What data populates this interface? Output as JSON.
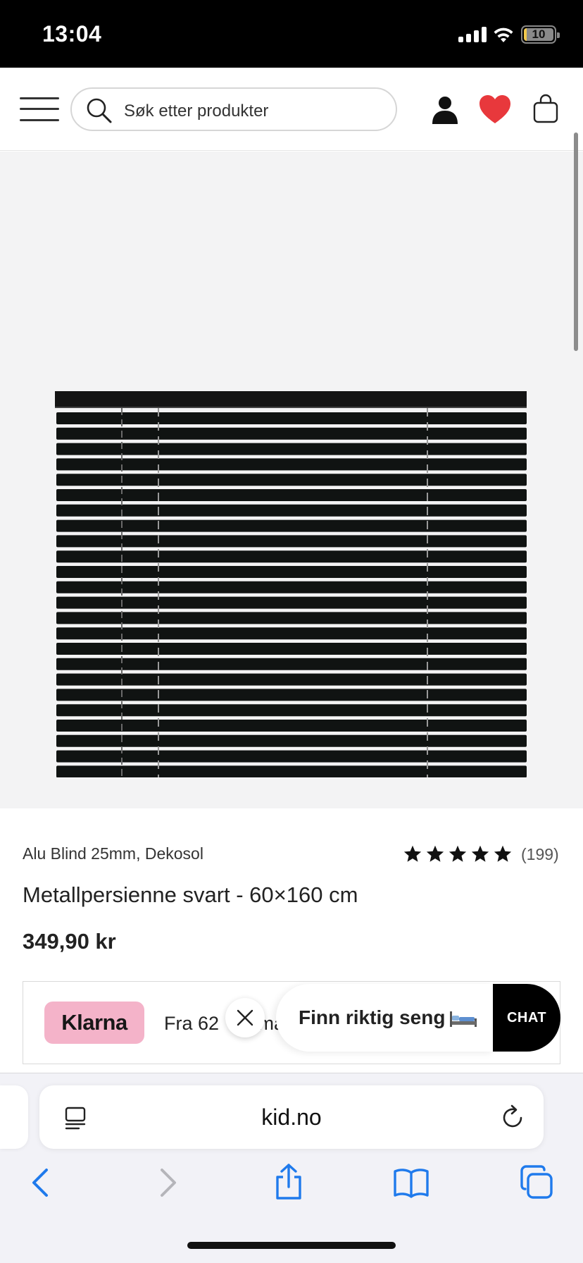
{
  "status_bar": {
    "time": "13:04",
    "battery_level": "10",
    "battery_fraction": 0.1,
    "icons": [
      "cellular-signal-icon",
      "wifi-icon",
      "battery-charging-icon"
    ]
  },
  "header": {
    "search_placeholder": "Søk etter produkter",
    "icons": [
      "menu-icon",
      "search-icon",
      "user-icon",
      "heart-icon",
      "bag-icon"
    ],
    "heart_color": "#e8383c"
  },
  "product": {
    "brand_line": "Alu Blind 25mm, Dekosol",
    "rating": 5,
    "review_count": "(199)",
    "title": "Metallpersienne svart - 60×160 cm",
    "price": "349,90 kr",
    "image_alt": "black aluminium blind"
  },
  "klarna": {
    "badge": "Klarna",
    "text": "Fra 62 ",
    "text_after": "må",
    "badge_color": "#f4b3c9"
  },
  "chat": {
    "bubble_text": "Finn riktig seng",
    "button_label": "CHAT"
  },
  "safari": {
    "url": "kid.no",
    "accent": "#1f7aec"
  }
}
